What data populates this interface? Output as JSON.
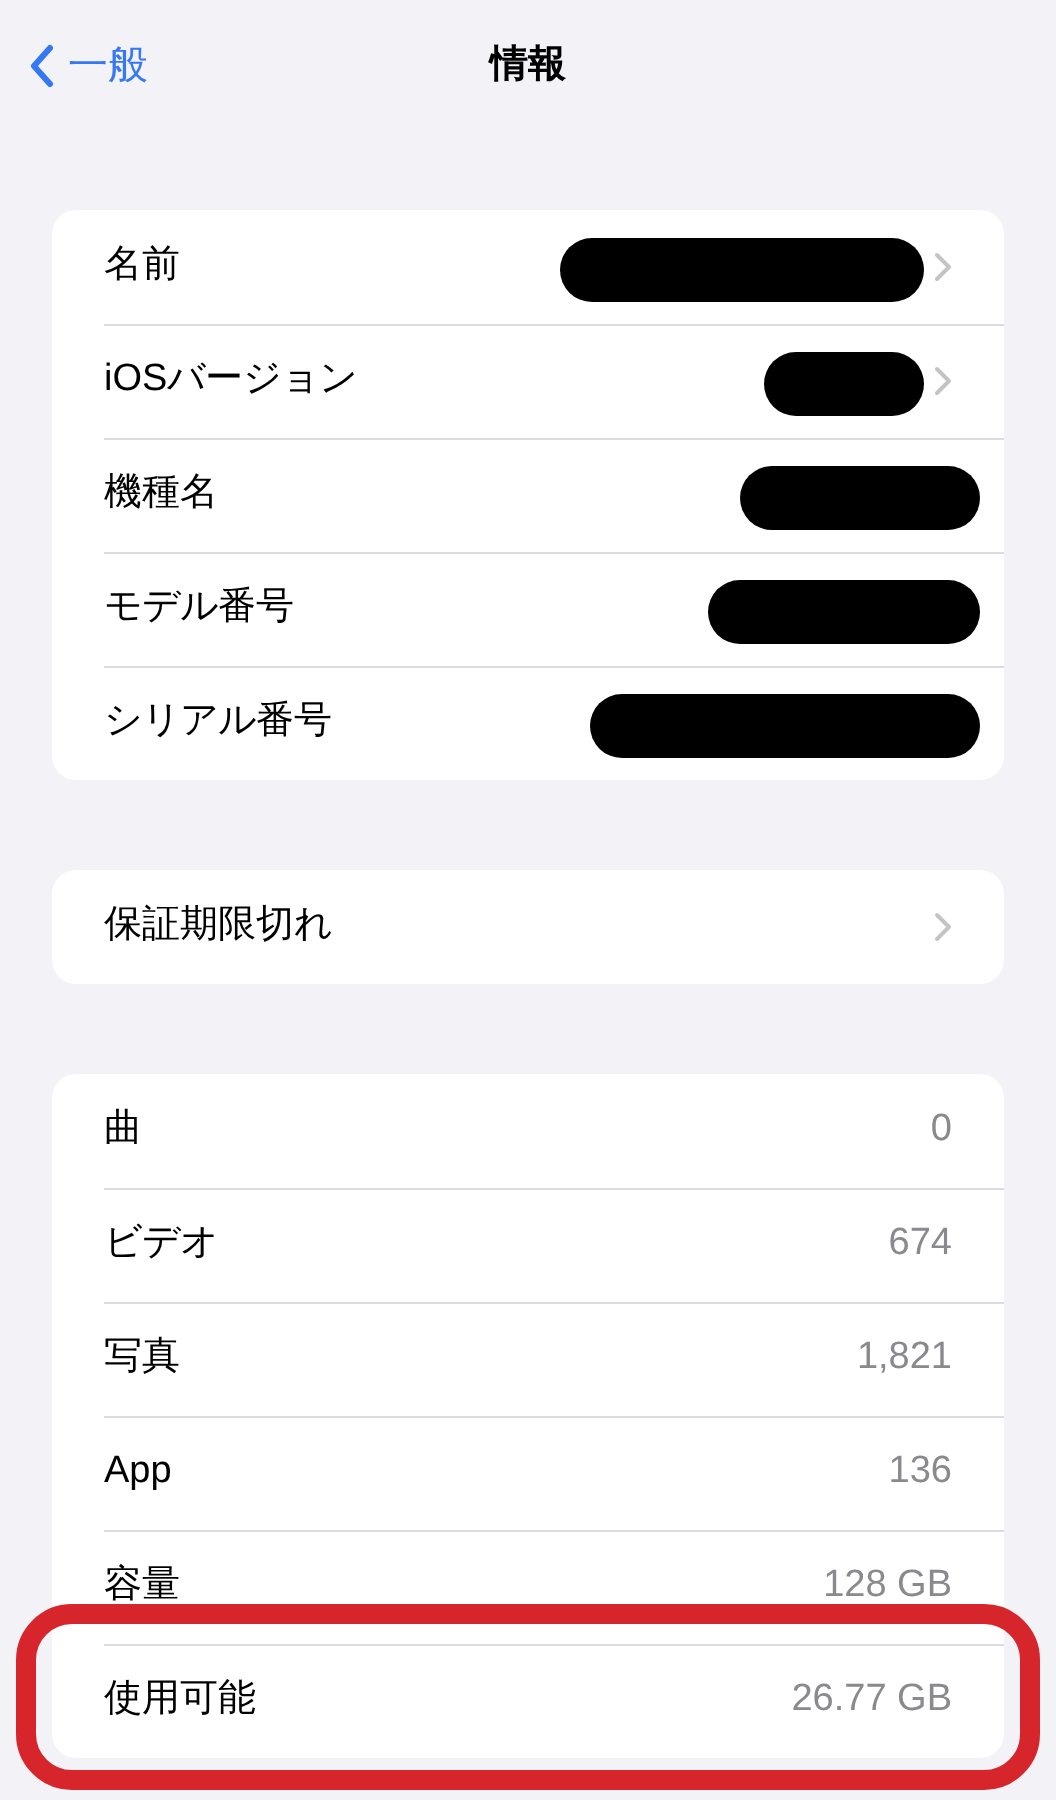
{
  "nav": {
    "back": "一般",
    "title": "情報"
  },
  "groups": [
    {
      "rows": [
        {
          "label": "名前",
          "chevron": true,
          "redacted": true
        },
        {
          "label": "iOSバージョン",
          "chevron": true,
          "redacted": true
        },
        {
          "label": "機種名",
          "chevron": false,
          "redacted": true
        },
        {
          "label": "モデル番号",
          "chevron": false,
          "redacted": true
        },
        {
          "label": "シリアル番号",
          "chevron": false,
          "redacted": true
        }
      ]
    },
    {
      "rows": [
        {
          "label": "保証期限切れ",
          "chevron": true,
          "redacted": false
        }
      ]
    },
    {
      "rows": [
        {
          "label": "曲",
          "value": "0",
          "chevron": false,
          "redacted": false
        },
        {
          "label": "ビデオ",
          "value": "674",
          "chevron": false,
          "redacted": false
        },
        {
          "label": "写真",
          "value": "1,821",
          "chevron": false,
          "redacted": false
        },
        {
          "label": "App",
          "value": "136",
          "chevron": false,
          "redacted": false
        },
        {
          "label": "容量",
          "value": "128 GB",
          "chevron": false,
          "redacted": false
        },
        {
          "label": "使用可能",
          "value": "26.77 GB",
          "chevron": false,
          "redacted": false,
          "highlighted": true
        }
      ]
    }
  ]
}
